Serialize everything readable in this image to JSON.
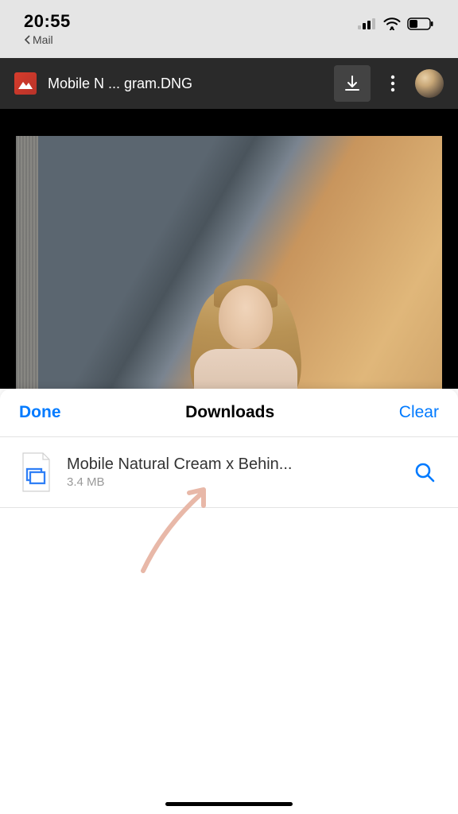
{
  "status_bar": {
    "time": "20:55",
    "back_label": "Mail"
  },
  "app_header": {
    "filename": "Mobile N ... gram.DNG"
  },
  "sheet": {
    "done_label": "Done",
    "title": "Downloads",
    "clear_label": "Clear",
    "items": [
      {
        "name": "Mobile Natural Cream x Behin...",
        "size": "3.4 MB"
      }
    ]
  }
}
